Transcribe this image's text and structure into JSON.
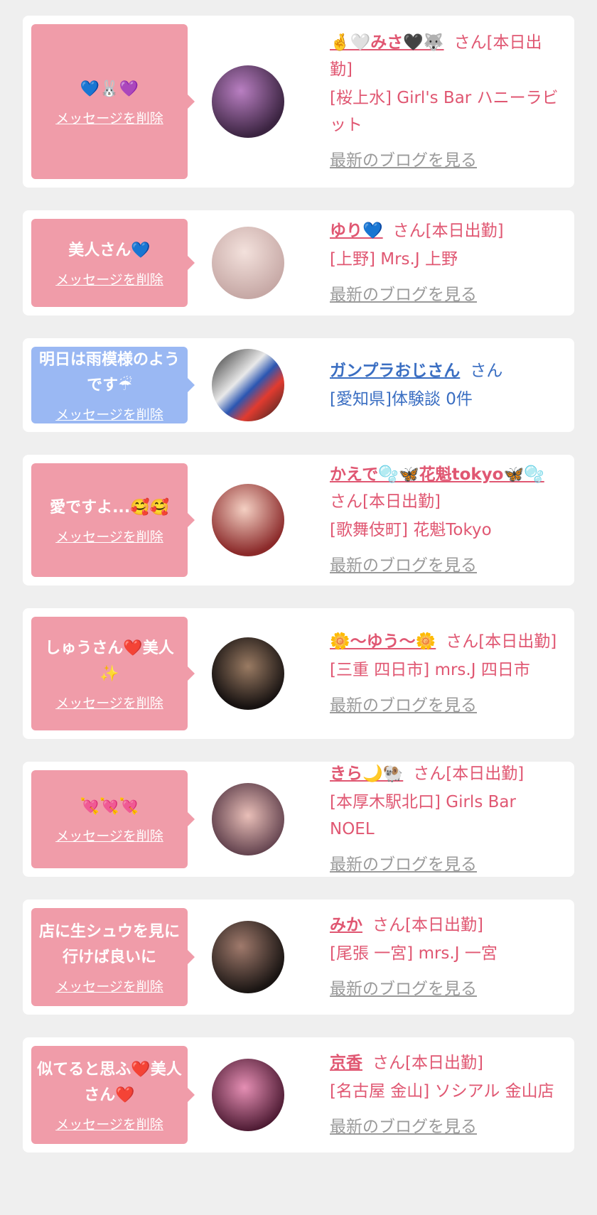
{
  "delete_label": "メッセージを削除",
  "blog_label": "最新のブログを見る",
  "colors": {
    "pink": "#f09ca9",
    "blue": "#9ab8f3",
    "name_pink": "#e05772",
    "name_blue": "#3a6ec2"
  },
  "items": [
    {
      "message": "💙🐰💜",
      "name": "🤞🤍みさ🖤🐺",
      "suffix": "さん[本日出勤]",
      "shop": "[桜上水] Girl's Bar ハニーラビット",
      "avatar": "avatar-photo"
    },
    {
      "message": "美人さん💙",
      "name": "ゆり💙",
      "suffix": "さん[本日出勤]",
      "shop": "[上野] Mrs.J 上野",
      "avatar": "avatar-photo"
    },
    {
      "message": "明日は雨模様のようです☔",
      "name": "ガンプラおじさん",
      "suffix": "さん",
      "shop": "[愛知県]体験談 0件",
      "avatar": "avatar-photo"
    },
    {
      "message": "愛ですよ...🥰🥰",
      "name": "かえで🫧🦋花魁tokyo🦋🫧",
      "suffix": "さん[本日出勤]",
      "shop": "[歌舞伎町] 花魁Tokyo",
      "avatar": "avatar-photo"
    },
    {
      "message": "しゅうさん❤️美人✨",
      "name": "🌼〜ゆう〜🌼",
      "suffix": "さん[本日出勤]",
      "shop": "[三重 四日市] mrs.J 四日市",
      "avatar": "avatar-photo"
    },
    {
      "message": "💘💘💘",
      "name": "きら🌙🐏",
      "suffix": "さん[本日出勤]",
      "shop": "[本厚木駅北口] Girls Bar NOEL",
      "avatar": "avatar-photo"
    },
    {
      "message": "店に生シュウを見に行けば良いに",
      "name": "みか",
      "suffix": "さん[本日出勤]",
      "shop": "[尾張 一宮] mrs.J 一宮",
      "avatar": "avatar-photo"
    },
    {
      "message": "似てると思ふ❤️美人さん❤️",
      "name": "京香",
      "suffix": "さん[本日出勤]",
      "shop": "[名古屋 金山] ソシアル 金山店",
      "avatar": "avatar-photo"
    }
  ]
}
